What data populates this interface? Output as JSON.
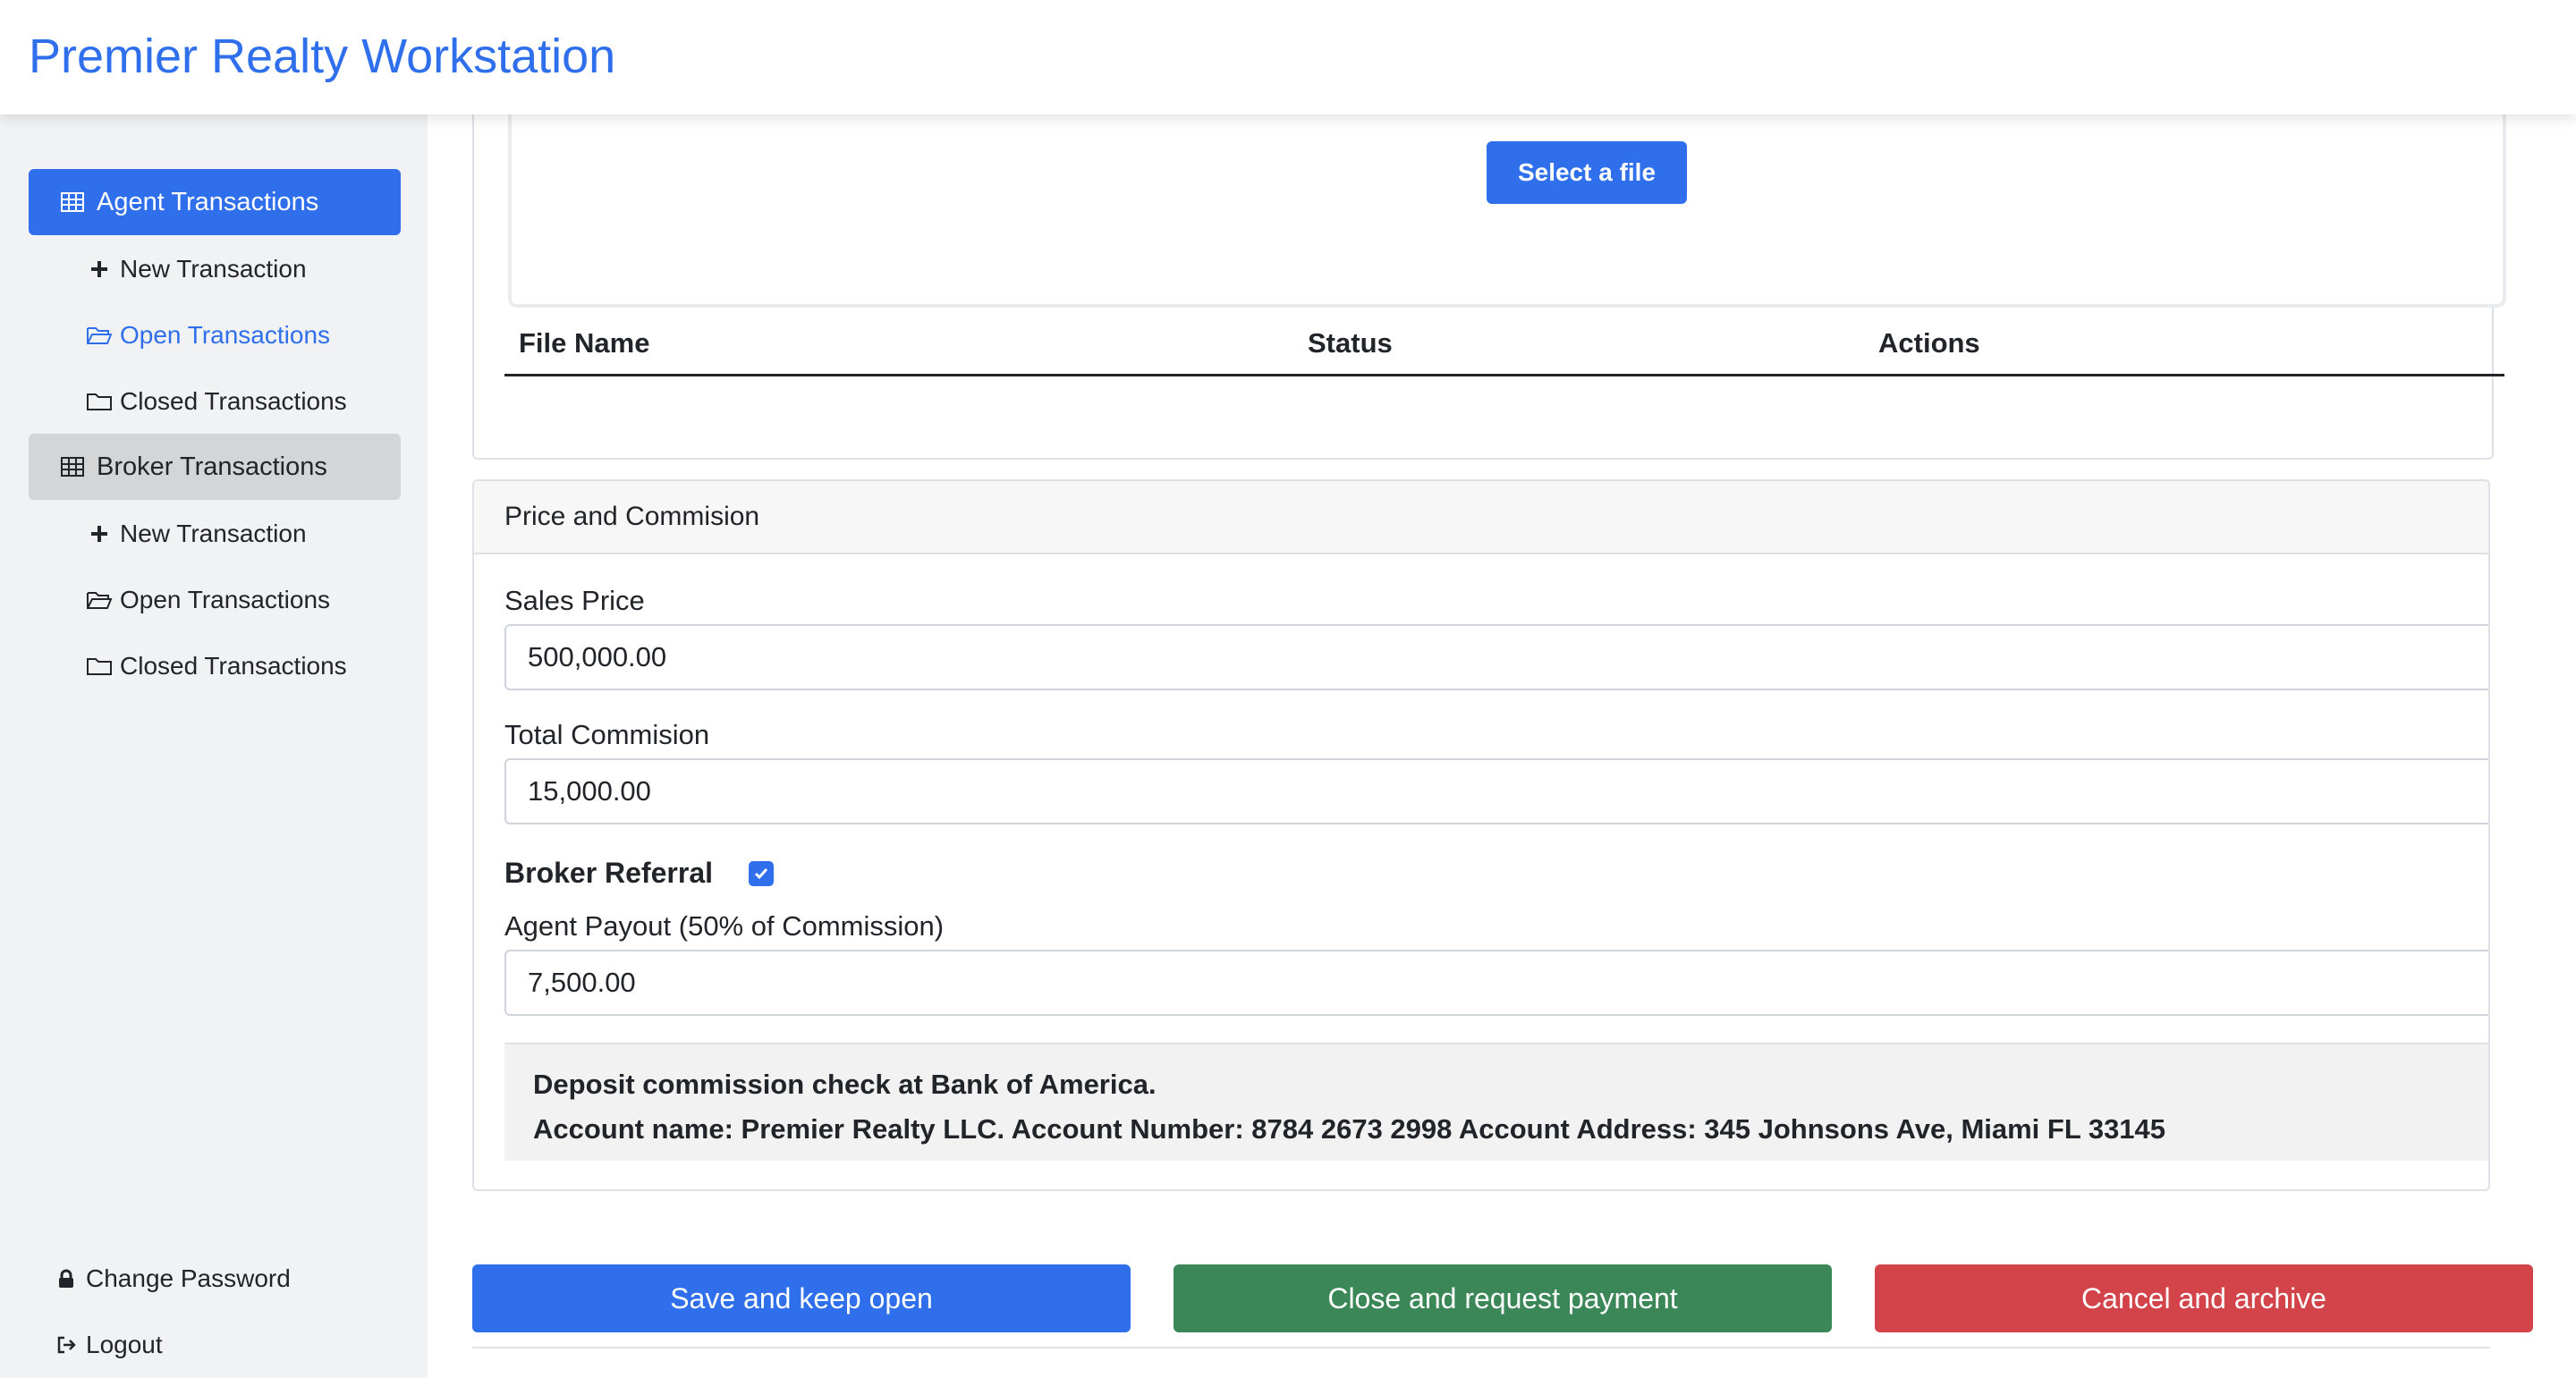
{
  "app": {
    "title": "Premier Realty Workstation"
  },
  "colors": {
    "primary": "#2f6fec",
    "success": "#3c8758",
    "danger": "#d2434a"
  },
  "sidebar": {
    "agent_group": {
      "label": "Agent Transactions",
      "icon": "table-icon"
    },
    "agent_items": [
      {
        "label": "New Transaction",
        "icon": "plus-icon"
      },
      {
        "label": "Open Transactions",
        "icon": "folder-open-icon"
      },
      {
        "label": "Closed Transactions",
        "icon": "folder-icon"
      }
    ],
    "broker_group": {
      "label": "Broker Transactions",
      "icon": "table-icon"
    },
    "broker_items": [
      {
        "label": "New Transaction",
        "icon": "plus-icon"
      },
      {
        "label": "Open Transactions",
        "icon": "folder-open-icon"
      },
      {
        "label": "Closed Transactions",
        "icon": "folder-icon"
      }
    ],
    "footer": [
      {
        "label": "Change Password",
        "icon": "lock-icon"
      },
      {
        "label": "Logout",
        "icon": "logout-icon"
      }
    ]
  },
  "upload": {
    "select_label": "Select a file",
    "columns": [
      "File Name",
      "Status",
      "Actions"
    ]
  },
  "price": {
    "header": "Price and Commision",
    "sales_price": {
      "label": "Sales Price",
      "value": "500,000.00"
    },
    "total_commission": {
      "label": "Total Commision",
      "value": "15,000.00"
    },
    "broker_referral": {
      "label": "Broker Referral",
      "checked": true
    },
    "agent_payout": {
      "label": "Agent Payout (50% of Commission)",
      "value": "7,500.00"
    },
    "note_line1": "Deposit commission check at Bank of America.",
    "note_line2": "Account name: Premier Realty LLC. Account Number: 8784 2673 2998 Account Address: 345 Johnsons Ave, Miami FL 33145"
  },
  "actions": {
    "save": "Save and keep open",
    "close": "Close and request payment",
    "cancel": "Cancel and archive"
  }
}
